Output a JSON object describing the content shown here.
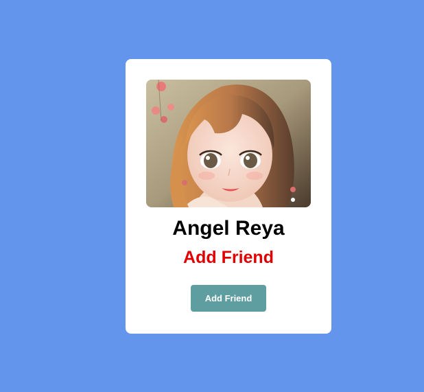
{
  "profile": {
    "name": "Angel Reya",
    "subtitle": "Add Friend",
    "button_label": "Add Friend",
    "avatar_icon": "profile-photo"
  },
  "colors": {
    "background": "#6495ED",
    "card": "#FFFFFF",
    "subtitle": "#E00000",
    "button": "#5F9EA0",
    "button_text": "#FFFFFF"
  }
}
